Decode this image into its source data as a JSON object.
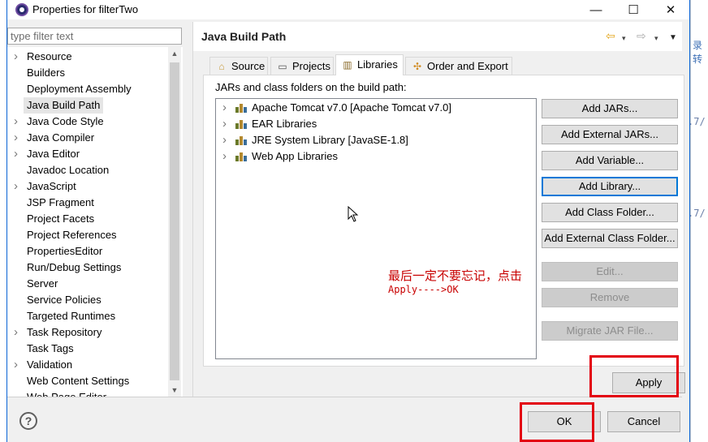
{
  "window": {
    "title": "Properties for filterTwo",
    "minimize": "—",
    "maximize": "☐",
    "close": "✕"
  },
  "filter": {
    "placeholder": "type filter text",
    "value": ""
  },
  "tree": {
    "items": [
      {
        "label": "Resource",
        "expandable": true,
        "selected": false
      },
      {
        "label": "Builders",
        "expandable": false,
        "selected": false
      },
      {
        "label": "Deployment Assembly",
        "expandable": false,
        "selected": false
      },
      {
        "label": "Java Build Path",
        "expandable": false,
        "selected": true
      },
      {
        "label": "Java Code Style",
        "expandable": true,
        "selected": false
      },
      {
        "label": "Java Compiler",
        "expandable": true,
        "selected": false
      },
      {
        "label": "Java Editor",
        "expandable": true,
        "selected": false
      },
      {
        "label": "Javadoc Location",
        "expandable": false,
        "selected": false
      },
      {
        "label": "JavaScript",
        "expandable": true,
        "selected": false
      },
      {
        "label": "JSP Fragment",
        "expandable": false,
        "selected": false
      },
      {
        "label": "Project Facets",
        "expandable": false,
        "selected": false
      },
      {
        "label": "Project References",
        "expandable": false,
        "selected": false
      },
      {
        "label": "PropertiesEditor",
        "expandable": false,
        "selected": false
      },
      {
        "label": "Run/Debug Settings",
        "expandable": false,
        "selected": false
      },
      {
        "label": "Server",
        "expandable": false,
        "selected": false
      },
      {
        "label": "Service Policies",
        "expandable": false,
        "selected": false
      },
      {
        "label": "Targeted Runtimes",
        "expandable": false,
        "selected": false
      },
      {
        "label": "Task Repository",
        "expandable": true,
        "selected": false
      },
      {
        "label": "Task Tags",
        "expandable": false,
        "selected": false
      },
      {
        "label": "Validation",
        "expandable": true,
        "selected": false
      },
      {
        "label": "Web Content Settings",
        "expandable": false,
        "selected": false
      },
      {
        "label": "Web Page Editor",
        "expandable": false,
        "selected": false
      }
    ]
  },
  "page": {
    "title": "Java Build Path",
    "nav_back": "⇦",
    "nav_fwd": "⇨",
    "nav_dropdown": "▾",
    "menu": "▼"
  },
  "tabs": [
    {
      "label": "Source",
      "active": false
    },
    {
      "label": "Projects",
      "active": false
    },
    {
      "label": "Libraries",
      "active": true
    },
    {
      "label": "Order and Export",
      "active": false
    }
  ],
  "libraries": {
    "heading": "JARs and class folders on the build path:",
    "items": [
      "Apache Tomcat v7.0 [Apache Tomcat v7.0]",
      "EAR Libraries",
      "JRE System Library [JavaSE-1.8]",
      "Web App Libraries"
    ]
  },
  "buttons": {
    "add_jars": "Add JARs...",
    "add_external_jars": "Add External JARs...",
    "add_variable": "Add Variable...",
    "add_library": "Add Library...",
    "add_class_folder": "Add Class Folder...",
    "add_external_class_folder": "Add External Class Folder...",
    "edit": "Edit...",
    "remove": "Remove",
    "migrate_jar": "Migrate JAR File...",
    "apply": "Apply",
    "ok": "OK",
    "cancel": "Cancel"
  },
  "annotation": {
    "line1": "最后一定不要忘记，点击",
    "line2": "Apply---->OK",
    "color": "#c80000"
  },
  "background_editor": {
    "snippets": [
      "录转",
      ".7/",
      ".7/"
    ]
  },
  "colors": {
    "accent": "#0078d7",
    "highlight": "#e3000f"
  }
}
